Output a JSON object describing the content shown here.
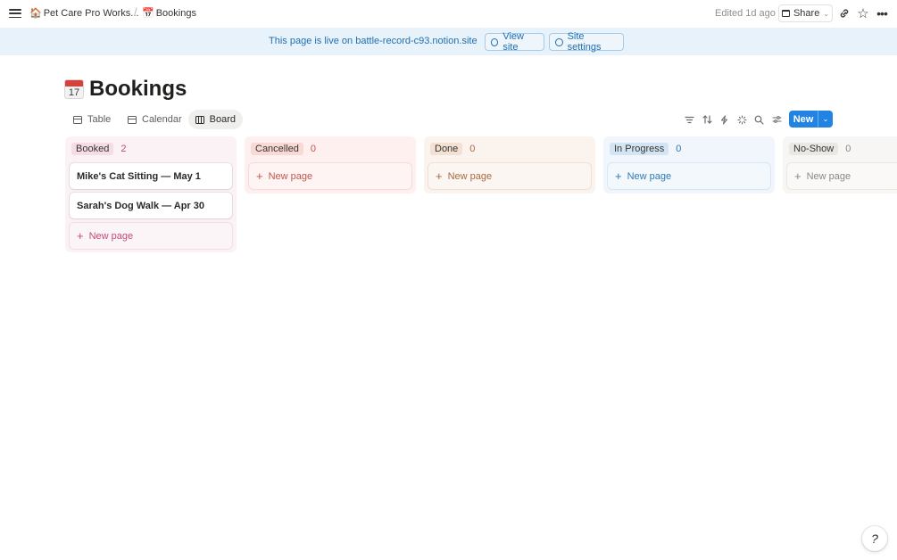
{
  "topbar": {
    "workspace_emoji": "🏠",
    "workspace_name": "Pet Care Pro Works...",
    "separator": "/",
    "page_emoji": "📅",
    "page_name": "Bookings",
    "edited": "Edited 1d ago",
    "share_label": "Share",
    "icons": {
      "menu": "hamburger-icon",
      "link": "link-icon",
      "favorite": "star-icon",
      "more": "more-icon"
    }
  },
  "banner": {
    "text": "This page is live on battle-record-c93.notion.site",
    "view_site": "View site",
    "site_settings": "Site settings"
  },
  "page": {
    "calendar_day": "17",
    "title": "Bookings"
  },
  "views": {
    "tabs": [
      {
        "label": "Table",
        "icon": "table-icon"
      },
      {
        "label": "Calendar",
        "icon": "calendar-icon"
      },
      {
        "label": "Board",
        "icon": "board-icon",
        "active": true
      }
    ],
    "new_label": "New"
  },
  "board": {
    "new_page_label": "New page",
    "columns": [
      {
        "label": "Booked",
        "count": "2",
        "pill_color": "#f5dce6",
        "text_color": "#c24b7a",
        "cards": [
          "Mike's Cat Sitting — May 1",
          "Sarah's Dog Walk — Apr 30"
        ]
      },
      {
        "label": "Cancelled",
        "count": "0",
        "pill_color": "#f8d9d5",
        "text_color": "#c4554d",
        "cards": []
      },
      {
        "label": "Done",
        "count": "0",
        "pill_color": "#f3e2d4",
        "text_color": "#a86a3f",
        "cards": []
      },
      {
        "label": "In Progress",
        "count": "0",
        "pill_color": "#d3e5f4",
        "text_color": "#2e79b8",
        "cards": []
      },
      {
        "label": "No-Show",
        "count": "0",
        "pill_color": "#e9e8e5",
        "text_color": "#8a8884",
        "cards": []
      }
    ]
  },
  "colors": {
    "accent": "#2383e2",
    "banner_bg": "#e7f2fb",
    "banner_text": "#1f6fb2"
  }
}
